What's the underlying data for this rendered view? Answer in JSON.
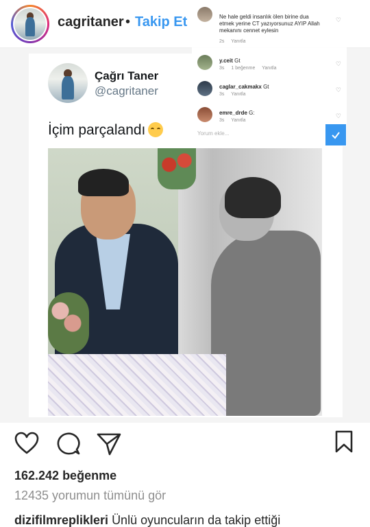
{
  "header": {
    "username": "cagritaner",
    "separator": "•",
    "follow_label": "Takip Et"
  },
  "tweet": {
    "name": "Çağrı Taner",
    "handle": "@cagritaner",
    "text": "İçim parçalandı"
  },
  "comments_overlay": {
    "comments": [
      {
        "name": "",
        "text": "Ne hale geldi insanlık ölen birine dua etmek yerine CT yazıyorsunuz AYIP Allah mekanını cennet eylesin",
        "meta_time": "2s",
        "meta_likes": "",
        "meta_reply": "Yanıtla"
      },
      {
        "name": "y.ceit",
        "text": "Gt",
        "meta_time": "3s",
        "meta_likes": "1 beğenme",
        "meta_reply": "Yanıtla"
      },
      {
        "name": "caglar_cakmakx",
        "text": "Gt",
        "meta_time": "3s",
        "meta_likes": "",
        "meta_reply": "Yanıtla"
      },
      {
        "name": "emre_drde",
        "text": "G:",
        "meta_time": "3s",
        "meta_likes": "",
        "meta_reply": "Yanıtla"
      }
    ],
    "input_placeholder": "Yorum ekle..."
  },
  "actions": {
    "like_icon": "heart-icon",
    "comment_icon": "comment-icon",
    "share_icon": "share-icon",
    "save_icon": "bookmark-icon"
  },
  "stats": {
    "likes": "162.242 beğenme",
    "view_comments": "12435 yorumun tümünü gör"
  },
  "caption": {
    "username": "dizifilmreplikleri",
    "text": "Ünlü oyuncuların da takip ettiği"
  },
  "colors": {
    "accent": "#3897f0",
    "text": "#262626",
    "muted": "#8e8e8e"
  }
}
